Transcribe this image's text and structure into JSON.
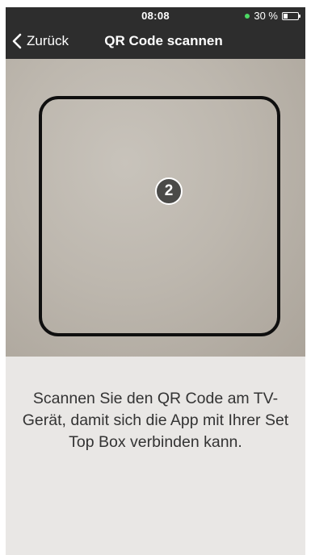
{
  "status_bar": {
    "time": "08:08",
    "battery_text": "30 %",
    "battery_level": 0.3
  },
  "nav": {
    "back_label": "Zurück",
    "title": "QR Code scannen"
  },
  "scanner": {
    "step_number": "2"
  },
  "instruction": {
    "text": "Scannen Sie den QR Code am TV-Gerät, damit sich die App mit Ihrer Set Top Box verbinden kann."
  },
  "colors": {
    "nav_background": "#2d2d2d",
    "battery_indicator": "#4cd964"
  },
  "icons": {
    "back": "chevron-left-icon",
    "battery": "battery-icon"
  }
}
